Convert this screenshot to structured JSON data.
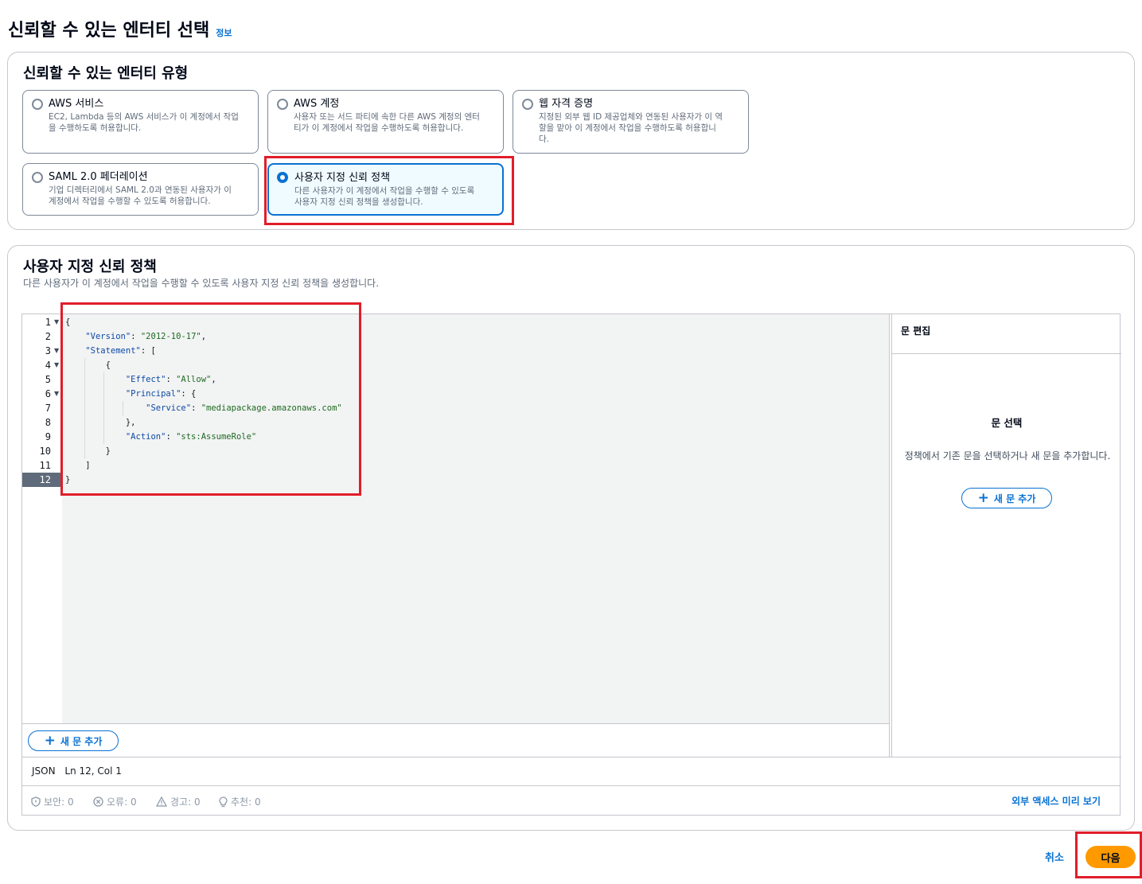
{
  "page": {
    "title": "신뢰할 수 있는 엔터티 선택",
    "info": "정보"
  },
  "entity_type": {
    "title": "신뢰할 수 있는 엔터티 유형",
    "options": [
      {
        "label": "AWS 서비스",
        "desc1": "EC2, Lambda 등의 AWS 서비스가 이 계정에서 작업",
        "desc2": "을 수행하도록 허용합니다.",
        "desc3": "",
        "selected": false
      },
      {
        "label": "AWS 계정",
        "desc1": "사용자 또는 서드 파티에 속한 다른 AWS 계정의 엔터",
        "desc2": "티가 이 계정에서 작업을 수행하도록 허용합니다.",
        "desc3": "",
        "selected": false
      },
      {
        "label": "웹 자격 증명",
        "desc1": "지정된 외부 웹 ID 제공업체와 연동된 사용자가 이 역",
        "desc2": "할을 맡아 이 계정에서 작업을 수행하도록 허용합니",
        "desc3": "다.",
        "selected": false
      },
      {
        "label": "SAML 2.0 페더레이션",
        "desc1": "기업 디렉터리에서 SAML 2.0과 연동된 사용자가 이",
        "desc2": "계정에서 작업을 수행할 수 있도록 허용합니다.",
        "desc3": "",
        "selected": false
      },
      {
        "label": "사용자 지정 신뢰 정책",
        "desc1": "다른 사용자가 이 계정에서 작업을 수행할 수 있도록",
        "desc2": "사용자 지정 신뢰 정책을 생성합니다.",
        "desc3": "",
        "selected": true
      }
    ]
  },
  "custom_policy": {
    "title": "사용자 지정 신뢰 정책",
    "description": "다른 사용자가 이 계정에서 작업을 수행할 수 있도록 사용자 지정 신뢰 정책을 생성합니다.",
    "line_numbers": [
      "1",
      "2",
      "3",
      "4",
      "5",
      "6",
      "7",
      "8",
      "9",
      "10",
      "11",
      "12"
    ],
    "code": {
      "l1": "{",
      "version_key": "\"Version\"",
      "version_val": "\"2012-10-17\"",
      "statement_key": "\"Statement\"",
      "l4": "{",
      "effect_key": "\"Effect\"",
      "effect_val": "\"Allow\"",
      "principal_key": "\"Principal\"",
      "service_key": "\"Service\"",
      "service_val": "\"mediapackage.amazonaws.com\"",
      "l8": "},",
      "action_key": "\"Action\"",
      "action_val": "\"sts:AssumeRole\"",
      "l10": "}",
      "l11": "]",
      "l12": "}"
    },
    "add_statement": "새 문 추가",
    "status": {
      "language": "JSON",
      "position": "Ln 12, Col 1"
    },
    "checks": {
      "security": "보안: 0",
      "errors": "오류: 0",
      "warnings": "경고: 0",
      "suggestions": "추천: 0"
    },
    "preview_link": "외부 액세스 미리 보기",
    "side": {
      "title": "문 편집",
      "empty_title": "문 선택",
      "empty_desc": "정책에서 기존 문을 선택하거나 새 문을 추가합니다.",
      "add_button": "새 문 추가"
    }
  },
  "footer": {
    "cancel": "취소",
    "next": "다음"
  },
  "colors": {
    "accent": "#0972d3",
    "primary_button": "#ff9900",
    "highlight": "#e11d2a"
  }
}
